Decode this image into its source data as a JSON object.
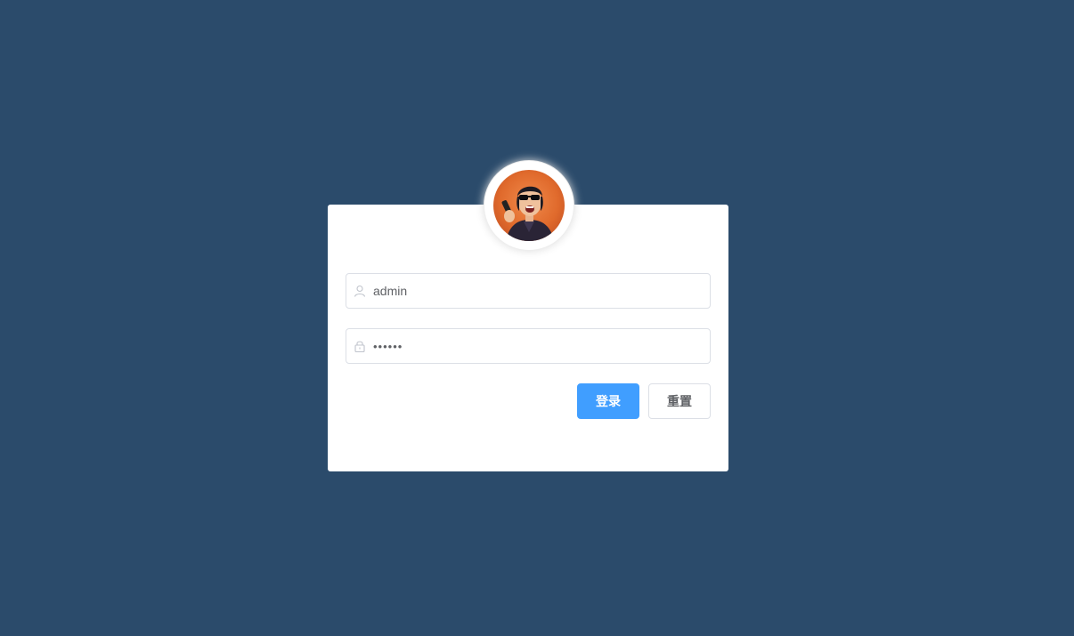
{
  "login": {
    "username_value": "admin",
    "password_value": "••••••",
    "login_button": "登录",
    "reset_button": "重置"
  },
  "icons": {
    "username": "user-icon",
    "password": "lock-icon"
  },
  "colors": {
    "background": "#2b4b6b",
    "primary": "#409eff",
    "card": "#ffffff"
  }
}
